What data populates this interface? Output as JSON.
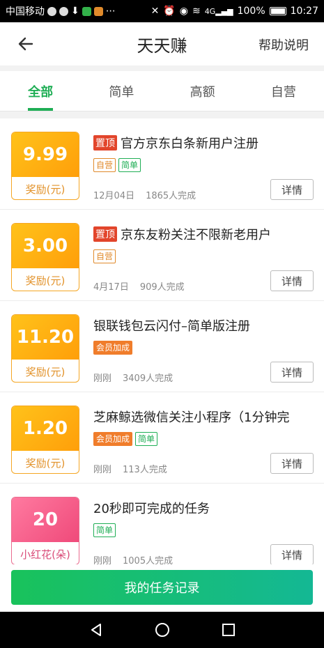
{
  "status_bar": {
    "carrier": "中国移动",
    "battery": "100%",
    "time": "10:27",
    "network": "4G"
  },
  "header": {
    "title": "天天赚",
    "help": "帮助说明"
  },
  "tabs": [
    {
      "label": "全部",
      "active": true
    },
    {
      "label": "简单",
      "active": false
    },
    {
      "label": "高额",
      "active": false
    },
    {
      "label": "自营",
      "active": false
    }
  ],
  "tasks": [
    {
      "amount": "9.99",
      "unit": "奖励(元)",
      "pinned": true,
      "pin_label": "置顶",
      "title": "官方京东白条新用户注册",
      "tags": [
        "自营",
        "简单"
      ],
      "date": "12月04日",
      "completed": "1865人完成",
      "detail": "详情"
    },
    {
      "amount": "3.00",
      "unit": "奖励(元)",
      "pinned": true,
      "pin_label": "置顶",
      "title": "京东友粉关注不限新老用户",
      "tags": [
        "自营"
      ],
      "date": "4月17日",
      "completed": "909人完成",
      "detail": "详情"
    },
    {
      "amount": "11.20",
      "unit": "奖励(元)",
      "pinned": false,
      "title": "银联钱包云闪付–简单版注册",
      "tags": [
        "会员加成"
      ],
      "date": "刚刚",
      "completed": "3409人完成",
      "detail": "详情"
    },
    {
      "amount": "1.20",
      "unit": "奖励(元)",
      "pinned": false,
      "title": "芝麻鲸选微信关注小程序（1分钟完",
      "tags": [
        "会员加成",
        "简单"
      ],
      "date": "刚刚",
      "completed": "113人完成",
      "detail": "详情"
    },
    {
      "amount": "20",
      "unit": "小红花(朵)",
      "pinned": false,
      "title": "20秒即可完成的任务",
      "tags": [
        "简单"
      ],
      "date": "刚刚",
      "completed": "1005人完成",
      "detail": "详情"
    }
  ],
  "bottom_button": {
    "label": "我的任务记录"
  },
  "colors": {
    "accent": "#1fae55",
    "reward": "#ffa90f",
    "flower": "#ef4a7a",
    "pin": "#e2452b"
  }
}
